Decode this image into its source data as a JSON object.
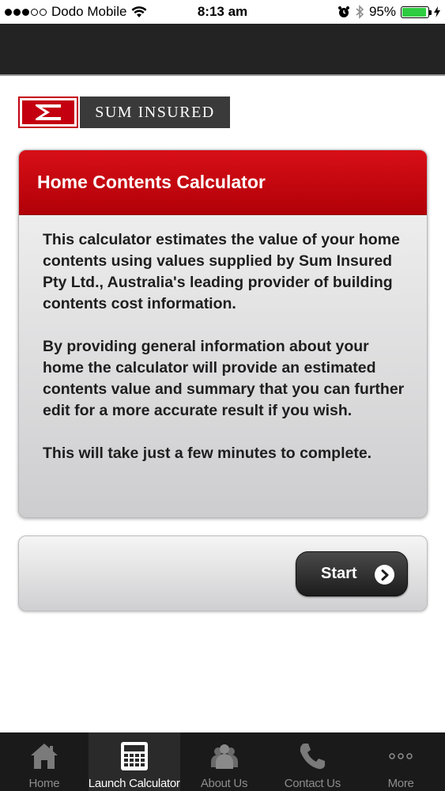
{
  "status_bar": {
    "carrier": "Dodo Mobile",
    "time": "8:13 am",
    "battery": "95%",
    "battery_level": 0.95,
    "signal_bars_filled": 3,
    "signal_bars_total": 5
  },
  "logo": {
    "text": "SUM INSURED",
    "brand_color": "#c40010"
  },
  "card": {
    "title": "Home Contents Calculator",
    "paragraphs": [
      "This calculator estimates the value of your home contents using values supplied by Sum Insured Pty Ltd., Australia's leading provider of building contents cost information.",
      "By providing general information about your home the calculator will provide an estimated contents value and summary that you can further edit for a more accurate result if you wish.",
      "This will take just a few minutes to complete."
    ]
  },
  "start_button": {
    "label": "Start",
    "icon": "chevron-right-icon"
  },
  "tabs": [
    {
      "label": "Home",
      "icon": "home-icon",
      "active": false
    },
    {
      "label": "Launch Calculator",
      "icon": "calculator-icon",
      "active": true
    },
    {
      "label": "About Us",
      "icon": "people-icon",
      "active": false
    },
    {
      "label": "Contact Us",
      "icon": "phone-icon",
      "active": false
    },
    {
      "label": "More",
      "icon": "more-dots-icon",
      "active": false
    }
  ],
  "colors": {
    "header_red": "#c40010",
    "dark_bar": "#232323",
    "battery_green": "#2ecc40"
  }
}
